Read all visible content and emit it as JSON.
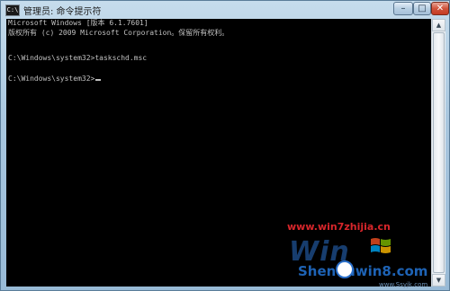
{
  "window": {
    "title": "管理员: 命令提示符",
    "icon_label": "C:\\",
    "controls": {
      "minimize": "–",
      "maximize": "□",
      "close": "✕"
    }
  },
  "console": {
    "lines": [
      "Microsoft Windows [版本 6.1.7601]",
      "版权所有 (c) 2009 Microsoft Corporation。保留所有权利。",
      "",
      "C:\\Windows\\system32>taskschd.msc",
      "",
      "C:\\Windows\\system32>"
    ]
  },
  "scrollbar": {
    "up": "▲",
    "down": "▼"
  },
  "watermark": {
    "url": "www.win7zhijia.cn",
    "logo_text": "Win",
    "brand": "Shenduwin8.com",
    "site": "www.Ssyjk.com"
  },
  "colors": {
    "console_bg": "#000000",
    "console_text": "#c0c0c0",
    "close_button": "#c53a22"
  }
}
